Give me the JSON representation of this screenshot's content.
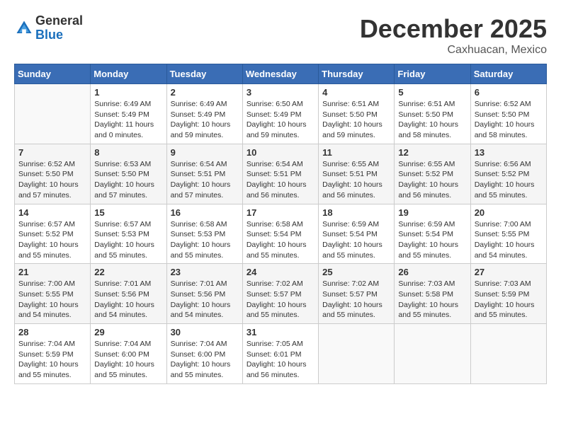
{
  "header": {
    "logo_line1": "General",
    "logo_line2": "Blue",
    "month": "December 2025",
    "location": "Caxhuacan, Mexico"
  },
  "columns": [
    "Sunday",
    "Monday",
    "Tuesday",
    "Wednesday",
    "Thursday",
    "Friday",
    "Saturday"
  ],
  "weeks": [
    [
      {
        "day": "",
        "info": ""
      },
      {
        "day": "1",
        "info": "Sunrise: 6:49 AM\nSunset: 5:49 PM\nDaylight: 11 hours\nand 0 minutes."
      },
      {
        "day": "2",
        "info": "Sunrise: 6:49 AM\nSunset: 5:49 PM\nDaylight: 10 hours\nand 59 minutes."
      },
      {
        "day": "3",
        "info": "Sunrise: 6:50 AM\nSunset: 5:49 PM\nDaylight: 10 hours\nand 59 minutes."
      },
      {
        "day": "4",
        "info": "Sunrise: 6:51 AM\nSunset: 5:50 PM\nDaylight: 10 hours\nand 59 minutes."
      },
      {
        "day": "5",
        "info": "Sunrise: 6:51 AM\nSunset: 5:50 PM\nDaylight: 10 hours\nand 58 minutes."
      },
      {
        "day": "6",
        "info": "Sunrise: 6:52 AM\nSunset: 5:50 PM\nDaylight: 10 hours\nand 58 minutes."
      }
    ],
    [
      {
        "day": "7",
        "info": "Sunrise: 6:52 AM\nSunset: 5:50 PM\nDaylight: 10 hours\nand 57 minutes."
      },
      {
        "day": "8",
        "info": "Sunrise: 6:53 AM\nSunset: 5:50 PM\nDaylight: 10 hours\nand 57 minutes."
      },
      {
        "day": "9",
        "info": "Sunrise: 6:54 AM\nSunset: 5:51 PM\nDaylight: 10 hours\nand 57 minutes."
      },
      {
        "day": "10",
        "info": "Sunrise: 6:54 AM\nSunset: 5:51 PM\nDaylight: 10 hours\nand 56 minutes."
      },
      {
        "day": "11",
        "info": "Sunrise: 6:55 AM\nSunset: 5:51 PM\nDaylight: 10 hours\nand 56 minutes."
      },
      {
        "day": "12",
        "info": "Sunrise: 6:55 AM\nSunset: 5:52 PM\nDaylight: 10 hours\nand 56 minutes."
      },
      {
        "day": "13",
        "info": "Sunrise: 6:56 AM\nSunset: 5:52 PM\nDaylight: 10 hours\nand 55 minutes."
      }
    ],
    [
      {
        "day": "14",
        "info": "Sunrise: 6:57 AM\nSunset: 5:52 PM\nDaylight: 10 hours\nand 55 minutes."
      },
      {
        "day": "15",
        "info": "Sunrise: 6:57 AM\nSunset: 5:53 PM\nDaylight: 10 hours\nand 55 minutes."
      },
      {
        "day": "16",
        "info": "Sunrise: 6:58 AM\nSunset: 5:53 PM\nDaylight: 10 hours\nand 55 minutes."
      },
      {
        "day": "17",
        "info": "Sunrise: 6:58 AM\nSunset: 5:54 PM\nDaylight: 10 hours\nand 55 minutes."
      },
      {
        "day": "18",
        "info": "Sunrise: 6:59 AM\nSunset: 5:54 PM\nDaylight: 10 hours\nand 55 minutes."
      },
      {
        "day": "19",
        "info": "Sunrise: 6:59 AM\nSunset: 5:54 PM\nDaylight: 10 hours\nand 55 minutes."
      },
      {
        "day": "20",
        "info": "Sunrise: 7:00 AM\nSunset: 5:55 PM\nDaylight: 10 hours\nand 54 minutes."
      }
    ],
    [
      {
        "day": "21",
        "info": "Sunrise: 7:00 AM\nSunset: 5:55 PM\nDaylight: 10 hours\nand 54 minutes."
      },
      {
        "day": "22",
        "info": "Sunrise: 7:01 AM\nSunset: 5:56 PM\nDaylight: 10 hours\nand 54 minutes."
      },
      {
        "day": "23",
        "info": "Sunrise: 7:01 AM\nSunset: 5:56 PM\nDaylight: 10 hours\nand 54 minutes."
      },
      {
        "day": "24",
        "info": "Sunrise: 7:02 AM\nSunset: 5:57 PM\nDaylight: 10 hours\nand 55 minutes."
      },
      {
        "day": "25",
        "info": "Sunrise: 7:02 AM\nSunset: 5:57 PM\nDaylight: 10 hours\nand 55 minutes."
      },
      {
        "day": "26",
        "info": "Sunrise: 7:03 AM\nSunset: 5:58 PM\nDaylight: 10 hours\nand 55 minutes."
      },
      {
        "day": "27",
        "info": "Sunrise: 7:03 AM\nSunset: 5:59 PM\nDaylight: 10 hours\nand 55 minutes."
      }
    ],
    [
      {
        "day": "28",
        "info": "Sunrise: 7:04 AM\nSunset: 5:59 PM\nDaylight: 10 hours\nand 55 minutes."
      },
      {
        "day": "29",
        "info": "Sunrise: 7:04 AM\nSunset: 6:00 PM\nDaylight: 10 hours\nand 55 minutes."
      },
      {
        "day": "30",
        "info": "Sunrise: 7:04 AM\nSunset: 6:00 PM\nDaylight: 10 hours\nand 55 minutes."
      },
      {
        "day": "31",
        "info": "Sunrise: 7:05 AM\nSunset: 6:01 PM\nDaylight: 10 hours\nand 56 minutes."
      },
      {
        "day": "",
        "info": ""
      },
      {
        "day": "",
        "info": ""
      },
      {
        "day": "",
        "info": ""
      }
    ]
  ]
}
